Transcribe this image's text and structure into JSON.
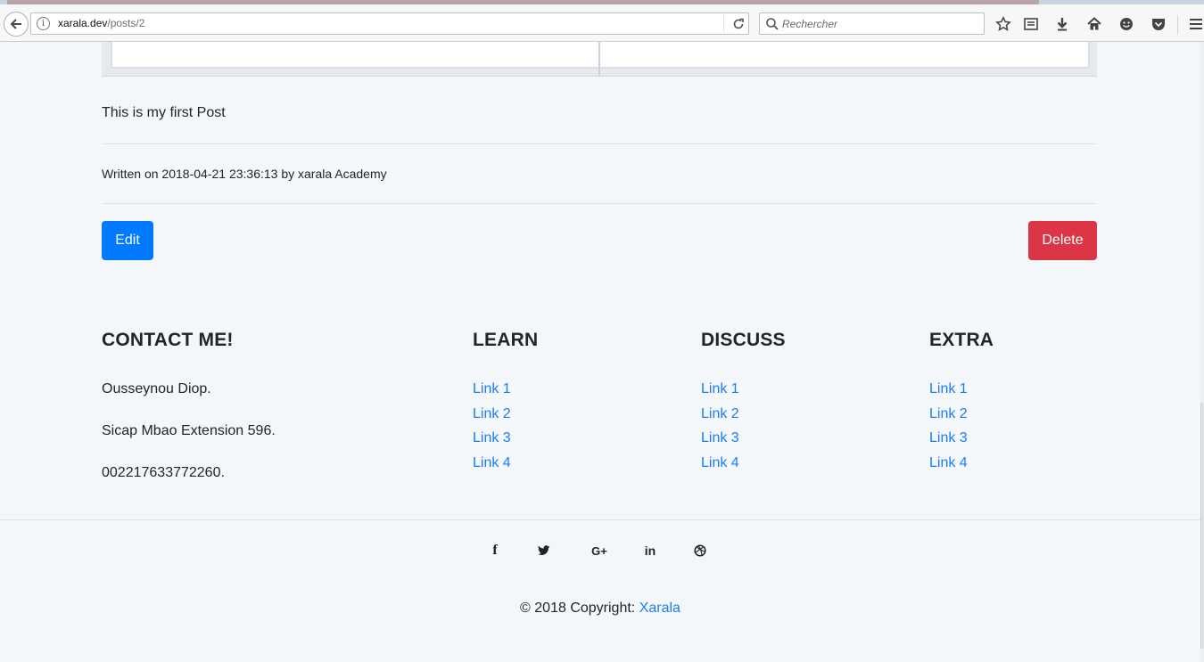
{
  "browser": {
    "url_host": "xarala.dev",
    "url_path": "/posts/2",
    "search_placeholder": "Rechercher"
  },
  "post": {
    "body": "This is my first Post",
    "meta": "Written on 2018-04-21 23:36:13 by xarala Academy",
    "edit_label": "Edit",
    "delete_label": "Delete"
  },
  "footer": {
    "contact": {
      "heading": "CONTACT ME!",
      "name": "Ousseynou Diop.",
      "address": "Sicap Mbao Extension 596.",
      "phone": "002217633772260."
    },
    "columns": [
      {
        "heading": "LEARN",
        "links": [
          "Link 1",
          "Link 2",
          "Link 3",
          "Link 4"
        ]
      },
      {
        "heading": "DISCUSS",
        "links": [
          "Link 1",
          "Link 2",
          "Link 3",
          "Link 4"
        ]
      },
      {
        "heading": "EXTRA",
        "links": [
          "Link 1",
          "Link 2",
          "Link 3",
          "Link 4"
        ]
      }
    ],
    "social": {
      "facebook": "f",
      "google_plus": "G+",
      "linkedin": "in"
    },
    "copyright_prefix": "© 2018 Copyright: ",
    "copyright_link": "Xarala"
  },
  "colors": {
    "primary": "#007bff",
    "danger": "#dc3545",
    "link": "#1a7ef0",
    "page_bg": "#f4f7fa"
  },
  "icons": [
    "back-arrow-icon",
    "info-icon",
    "reload-icon",
    "search-icon",
    "star-icon",
    "reading-list-icon",
    "download-icon",
    "home-icon",
    "smiley-icon",
    "pocket-icon",
    "menu-icon",
    "facebook-icon",
    "twitter-icon",
    "google-plus-icon",
    "linkedin-icon",
    "dribbble-icon"
  ]
}
